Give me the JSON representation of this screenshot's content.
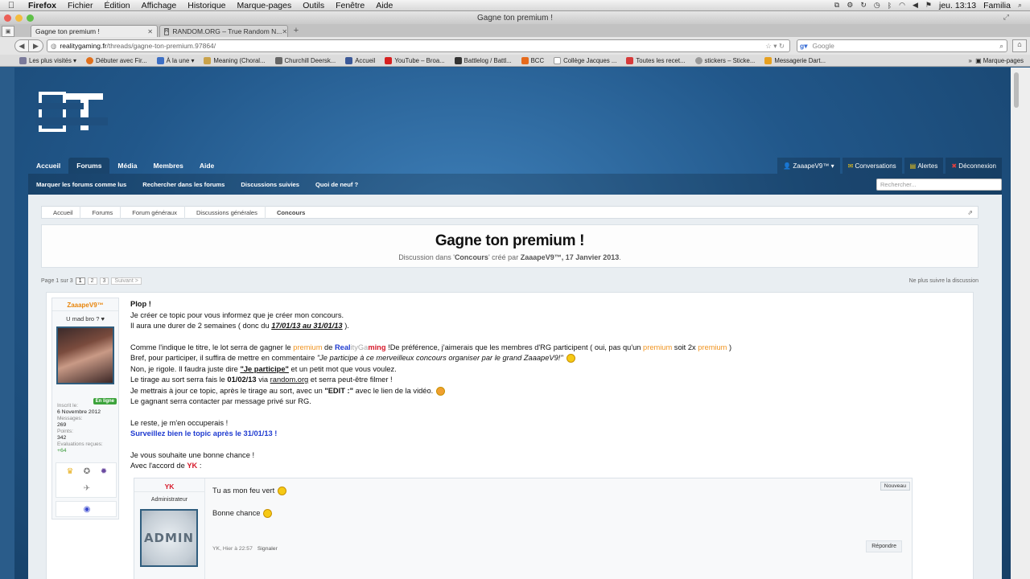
{
  "menubar": {
    "app": "Firefox",
    "items": [
      "Fichier",
      "Édition",
      "Affichage",
      "Historique",
      "Marque-pages",
      "Outils",
      "Fenêtre",
      "Aide"
    ],
    "clock": "jeu. 13:13",
    "user": "Familia"
  },
  "window": {
    "title": "Gagne ton premium !"
  },
  "tabs": [
    {
      "label": "Gagne ton premium !",
      "active": true
    },
    {
      "label": "RANDOM.ORG – True Random N...",
      "active": false
    }
  ],
  "navbar": {
    "url_host": "realitygaming.fr",
    "url_path": "/threads/gagne-ton-premium.97864/",
    "search_placeholder": "Google"
  },
  "bookmarks": {
    "items": [
      {
        "label": "Les plus visités",
        "color": "#7a7a9a"
      },
      {
        "label": "Débuter avec Fir...",
        "color": "#e0701c"
      },
      {
        "label": "À la une",
        "color": "#3d6fc4"
      },
      {
        "label": "Meaning (Choral...",
        "color": "#c9a24a"
      },
      {
        "label": "Churchill Deersk...",
        "color": "#666666"
      },
      {
        "label": "Accueil",
        "color": "#3b5998"
      },
      {
        "label": "YouTube – Broa...",
        "color": "#d62020"
      },
      {
        "label": "Battlelog / Battl...",
        "color": "#333333"
      },
      {
        "label": "BCC",
        "color": "#e66a1c"
      },
      {
        "label": "Collège Jacques ...",
        "color": "#ffffff"
      },
      {
        "label": "Toutes les recet...",
        "color": "#d63a3a"
      },
      {
        "label": "stickers – Sticke...",
        "color": "#9a9a9a"
      },
      {
        "label": "Messagerie Dart...",
        "color": "#e6a020"
      }
    ],
    "overflow_label": "Marque-pages"
  },
  "site": {
    "nav": [
      "Accueil",
      "Forums",
      "Média",
      "Membres",
      "Aide"
    ],
    "active_nav": "Forums",
    "user_menu": "ZaaapeV9™",
    "conversations": "Conversations",
    "alerts": "Alertes",
    "logout": "Déconnexion",
    "subnav": [
      "Marquer les forums comme lus",
      "Rechercher dans les forums",
      "Discussions suivies",
      "Quoi de neuf ?"
    ],
    "search_placeholder": "Rechercher..."
  },
  "breadcrumb": [
    "Accueil",
    "Forums",
    "Forum généraux",
    "Discussions générales",
    "Concours"
  ],
  "thread": {
    "title": "Gagne ton premium !",
    "meta_prefix": "Discussion dans '",
    "meta_forum": "Concours",
    "meta_mid": "' créé par ",
    "meta_author": "ZaaapeV9™",
    "meta_date": ", 17 Janvier 2013",
    "meta_end": "."
  },
  "pagination": {
    "label": "Page 1 sur 3",
    "pages": [
      "1",
      "2",
      "3"
    ],
    "next": "Suivant >",
    "unwatch": "Ne plus suivre la discussion"
  },
  "post_user": {
    "name": "ZaaapeV9™",
    "title": "U mad bro ? ♥",
    "online": "En ligne",
    "joined_label": "Inscrit le:",
    "joined": "6 Novembre 2012",
    "messages_label": "Messages:",
    "messages": "269",
    "points_label": "Points:",
    "points": "342",
    "ratings_label": "Evaluations reçues:",
    "ratings": "+64"
  },
  "message": {
    "l1": "Plop !",
    "l2": "Je créer ce topic pour vous informez que je créer mon concours.",
    "l3a": "Il aura une durer de 2 semaines ( donc du ",
    "l3b": "17/01/13 au 31/01/13",
    "l3c": " ).",
    "l4a": "Comme l'indique le titre, le lot serra de gagner le ",
    "l4b": "premium",
    "l4c": " de ",
    "l4d": "Real",
    "l4e": "ityGa",
    "l4f": "ming",
    "l4g": " !De préférence, j'aimerais que les membres d'RG participent ( oui, pas qu'un ",
    "l4h": "premium",
    "l4i": " soit 2x ",
    "l4j": "premium",
    "l4k": " )",
    "l5a": "Bref, pour participer, il suffira de mettre en commentaire ",
    "l5b": "\"Je participe à ce merveilleux concours organiser par le grand ZaaapeV9!\"",
    "l6a": "Non, je rigole. Il faudra juste dire ",
    "l6b": "\"Je participe\"",
    "l6c": " et un petit mot que vous voulez.",
    "l7a": "Le tirage au sort serra fais le ",
    "l7b": "01/02/13",
    "l7c": " via ",
    "l7d": "random.org",
    "l7e": " et serra peut-être filmer !",
    "l8a": "Je mettrais à jour ce topic, après le tirage au sort, avec un ",
    "l8b": "\"EDIT :\"",
    "l8c": " avec le lien de la vidéo.",
    "l9": "Le gagnant serra contacter par message privé sur RG.",
    "l10": "Le reste, je m'en occuperais !",
    "l11": "Surveillez bien le topic après le 31/01/13 !",
    "l12": "Je vous souhaite une bonne chance !",
    "l13a": "Avec l'accord de ",
    "l13b": "YK",
    "l13c": " :"
  },
  "quote": {
    "user": "YK",
    "role": "Administrateur",
    "avatar_text": "ADMIN",
    "line1": "Tu as mon feu vert",
    "line2": "Bonne chance",
    "new_badge": "Nouveau",
    "meta": "YK, Hier à 22:57",
    "report": "Signaler",
    "reply": "Répondre"
  },
  "colors": {
    "accent_orange": "#f0931e",
    "brand_blue": "#1f3bd0",
    "admin_red": "#d6192a",
    "online_green": "#3ca33c"
  }
}
